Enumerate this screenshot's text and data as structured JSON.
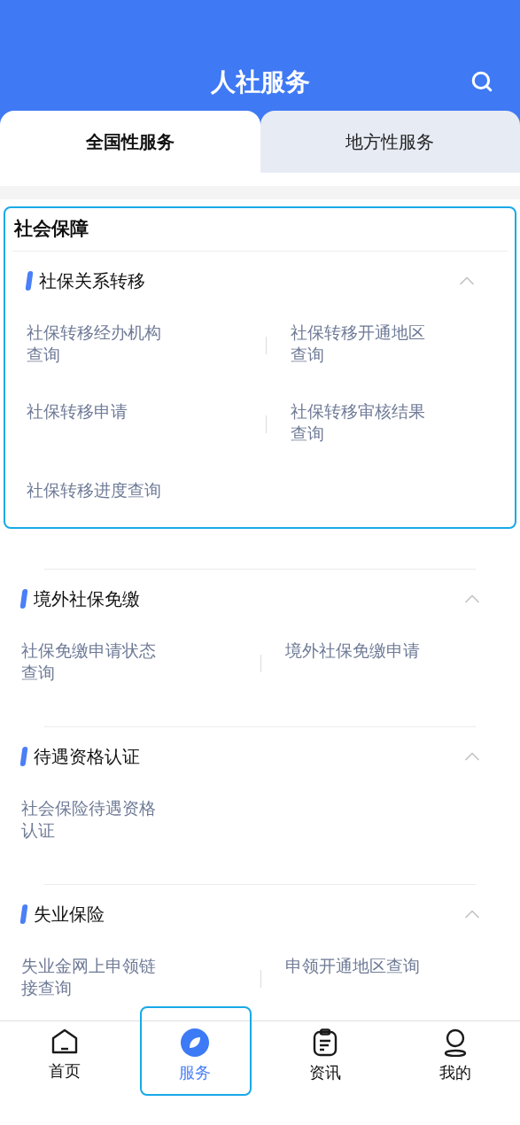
{
  "header": {
    "title": "人社服务"
  },
  "tabs": [
    {
      "label": "全国性服务",
      "selected": true
    },
    {
      "label": "地方性服务",
      "selected": false
    }
  ],
  "sections": [
    {
      "title": "社会保障",
      "focused": true,
      "categories": [
        {
          "title": "社保关系转移",
          "expanded": true,
          "items": [
            "社保转移经办机构查询",
            "社保转移开通地区查询",
            "社保转移申请",
            "社保转移审核结果查询",
            "社保转移进度查询"
          ]
        }
      ]
    },
    {
      "focused": false,
      "categories": [
        {
          "title": "境外社保免缴",
          "expanded": true,
          "items": [
            "社保免缴申请状态查询",
            "境外社保免缴申请"
          ]
        },
        {
          "title": "待遇资格认证",
          "expanded": true,
          "items": [
            "社会保险待遇资格认证"
          ]
        },
        {
          "title": "失业保险",
          "expanded": true,
          "items": [
            "失业金网上申领链接查询",
            "申领开通地区查询"
          ]
        }
      ]
    }
  ],
  "nav": [
    {
      "kind": "home",
      "label": "首页",
      "selected": false,
      "focused": false
    },
    {
      "kind": "service",
      "label": "服务",
      "selected": true,
      "focused": true
    },
    {
      "kind": "news",
      "label": "资讯",
      "selected": false,
      "focused": false
    },
    {
      "kind": "profile",
      "label": "我的",
      "selected": false,
      "focused": false
    }
  ]
}
